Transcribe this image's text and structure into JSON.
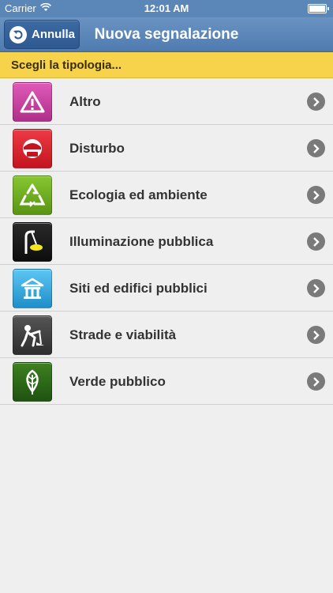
{
  "status_bar": {
    "carrier": "Carrier",
    "time": "12:01 AM",
    "wifi_icon": "wifi-icon",
    "battery_icon": "battery-icon"
  },
  "nav": {
    "back_label": "Annulla",
    "back_icon": "undo-arrow-icon",
    "title": "Nuova segnalazione"
  },
  "section_header": "Scegli la tipologia...",
  "categories": [
    {
      "label": "Altro",
      "icon": "warning-triangle-icon",
      "color": "#c93fa0"
    },
    {
      "label": "Disturbo",
      "icon": "police-helmet-icon",
      "color": "#d8222e"
    },
    {
      "label": "Ecologia ed ambiente",
      "icon": "recycle-icon",
      "color": "#6faa1f"
    },
    {
      "label": "Illuminazione pubblica",
      "icon": "street-lamp-icon",
      "color": "#1a1a1a"
    },
    {
      "label": "Siti ed edifici pubblici",
      "icon": "public-building-icon",
      "color": "#35a8de"
    },
    {
      "label": "Strade e viabilità",
      "icon": "road-worker-icon",
      "color": "#3f3f3f"
    },
    {
      "label": "Verde pubblico",
      "icon": "leaf-icon",
      "color": "#2c6a14"
    }
  ],
  "chevron_icon": "chevron-right-circle-icon"
}
